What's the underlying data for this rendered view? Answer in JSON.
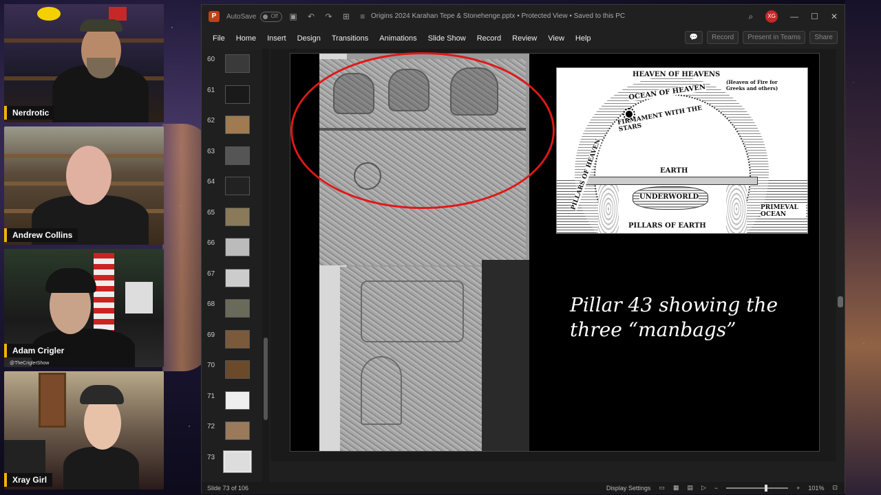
{
  "participants": [
    {
      "name": "Nerdrotic",
      "subtitle": ""
    },
    {
      "name": "Andrew Collins",
      "subtitle": ""
    },
    {
      "name": "Adam Crigler",
      "subtitle": "@TheCriglerShow"
    },
    {
      "name": "Xray Girl",
      "subtitle": ""
    }
  ],
  "app": {
    "autosave_label": "AutoSave",
    "autosave_state": "Off",
    "document_title": "Origins 2024 Karahan Tepe & Stonehenge.pptx  •  Protected View  •  Saved to this PC",
    "user_initials": "XG",
    "menu": [
      "File",
      "Home",
      "Insert",
      "Design",
      "Transitions",
      "Animations",
      "Slide Show",
      "Record",
      "Review",
      "View",
      "Help"
    ],
    "record_button": "Record",
    "present_teams_button": "Present in Teams",
    "share_button": "Share"
  },
  "thumbnails": [
    {
      "num": "60"
    },
    {
      "num": "61"
    },
    {
      "num": "62"
    },
    {
      "num": "63"
    },
    {
      "num": "64"
    },
    {
      "num": "65"
    },
    {
      "num": "66"
    },
    {
      "num": "67"
    },
    {
      "num": "68"
    },
    {
      "num": "69"
    },
    {
      "num": "70"
    },
    {
      "num": "71"
    },
    {
      "num": "72"
    },
    {
      "num": "73"
    }
  ],
  "active_slide": "73",
  "slide": {
    "diagram": {
      "heaven_of_heavens": "HEAVEN OF HEAVENS",
      "fire_note": "(Heaven of Fire for Greeks and others)",
      "ocean_of_heaven": "OCEAN OF HEAVEN",
      "firmament": "FIRMAMENT WITH THE STARS",
      "pillars_of_heaven": "PILLARS OF HEAVEN",
      "earth": "EARTH",
      "underworld": "UNDERWORLD",
      "primeval_ocean": "PRIMEVAL OCEAN",
      "pillars_of_earth": "PILLARS OF EARTH"
    },
    "caption_line1": "Pillar 43 showing the",
    "caption_line2": "three “manbags”"
  },
  "status": {
    "slide_counter": "Slide 73 of 106",
    "display_settings": "Display Settings",
    "zoom": "101%"
  }
}
